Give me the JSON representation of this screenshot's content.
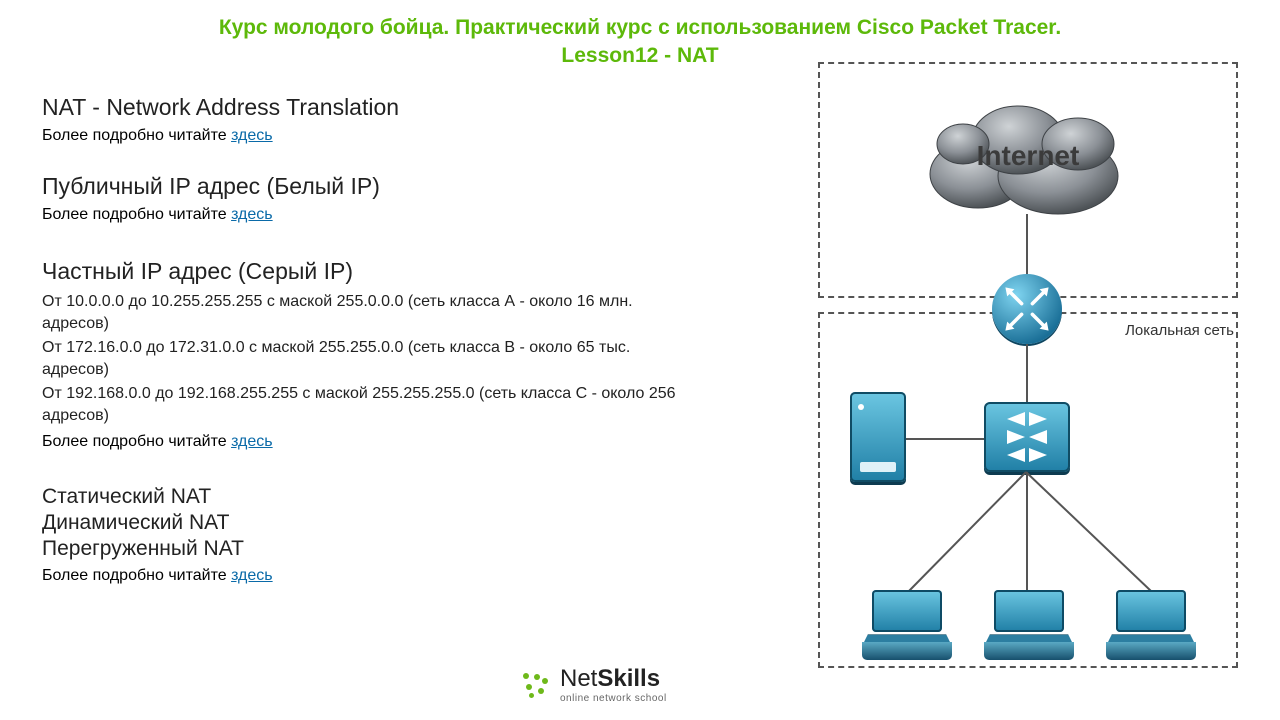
{
  "title": {
    "line1": "Курс молодого бойца. Практический курс с использованием Cisco Packet Tracer.",
    "line2": "Lesson12 - NAT"
  },
  "sections": {
    "nat": {
      "heading": "NAT - Network Address Translation",
      "more_prefix": "Более подробно читайте ",
      "more_link": "здесь"
    },
    "public_ip": {
      "heading": "Публичный IP адрес (Белый IP)",
      "more_prefix": "Более подробно читайте ",
      "more_link": "здесь"
    },
    "private_ip": {
      "heading": "Частный IP адрес (Серый IP)",
      "range_a": "От 10.0.0.0 до 10.255.255.255 с маской 255.0.0.0 (сеть класса А - около 16 млн. адресов)",
      "range_b": "От 172.16.0.0 до 172.31.0.0 с маской 255.255.0.0 (сеть класса В - около 65 тыс. адресов)",
      "range_c": "От 192.168.0.0 до 192.168.255.255 с маской 255.255.255.0 (сеть класса С - около 256 адресов)",
      "more_prefix": "Более подробно читайте ",
      "more_link": "здесь"
    },
    "nat_types": {
      "t1": "Статический NAT",
      "t2": "Динамический NAT",
      "t3": "Перегруженный NAT",
      "more_prefix": "Более подробно читайте ",
      "more_link": "здесь"
    }
  },
  "diagram": {
    "internet_label": "Internet",
    "lan_label": "Локальная сеть",
    "nodes": {
      "cloud": "internet-cloud",
      "router": "router",
      "switch": "switch",
      "server": "server",
      "laptop1": "laptop-1",
      "laptop2": "laptop-2",
      "laptop3": "laptop-3"
    }
  },
  "logo": {
    "brand_a": "Net",
    "brand_b": "Skills",
    "tagline": "online network school"
  }
}
